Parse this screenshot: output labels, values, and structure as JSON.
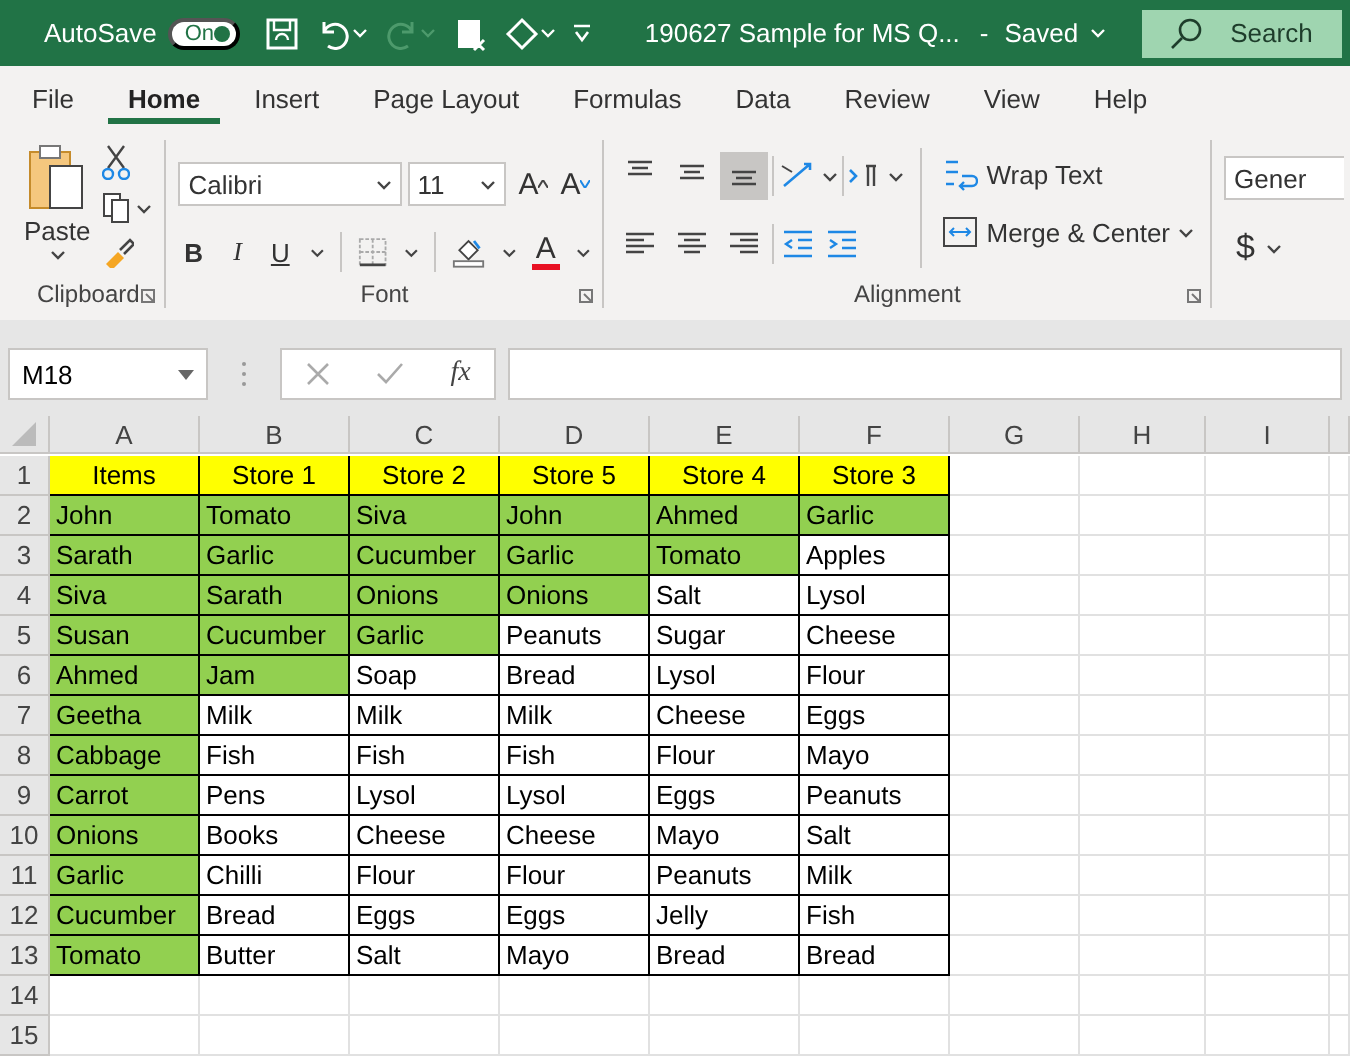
{
  "title_bar": {
    "autosave_label": "AutoSave",
    "autosave": {
      "label": "On",
      "on": true
    },
    "redo_disabled": true,
    "document_title": "190627 Sample for MS Q...",
    "separator": "-",
    "save_status": "Saved",
    "search": {
      "placeholder": "Search"
    }
  },
  "ribbon_tabs": [
    {
      "label": "File",
      "selected": false
    },
    {
      "label": "Home",
      "selected": true
    },
    {
      "label": "Insert",
      "selected": false
    },
    {
      "label": "Page Layout",
      "selected": false
    },
    {
      "label": "Formulas",
      "selected": false
    },
    {
      "label": "Data",
      "selected": false
    },
    {
      "label": "Review",
      "selected": false
    },
    {
      "label": "View",
      "selected": false
    },
    {
      "label": "Help",
      "selected": false
    }
  ],
  "ribbon": {
    "clipboard": {
      "paste": "Paste",
      "label": "Clipboard"
    },
    "font": {
      "name": "Calibri",
      "size": "11",
      "grow": "A",
      "shrink": "A",
      "bold": "B",
      "italic": "I",
      "underline": "U",
      "font_color": "A",
      "label": "Font"
    },
    "alignment": {
      "vertical": [
        {
          "kind": "top",
          "selected": false
        },
        {
          "kind": "middle",
          "selected": false
        },
        {
          "kind": "bottom",
          "selected": true
        }
      ],
      "wrap_text": "Wrap Text",
      "merge_center": "Merge & Center",
      "label": "Alignment"
    },
    "number": {
      "format": "Gener",
      "currency": "$"
    }
  },
  "formula_bar": {
    "name_box": "M18",
    "function_label": "fx"
  },
  "sheet": {
    "columns": [
      "A",
      "B",
      "C",
      "D",
      "E",
      "F",
      "G",
      "H",
      "I"
    ],
    "rows": [
      {
        "number": "1",
        "cells": [
          {
            "text": "Items",
            "color": "#ffff00"
          },
          {
            "text": "Store 1",
            "color": "#ffff00"
          },
          {
            "text": "Store 2",
            "color": "#ffff00"
          },
          {
            "text": "Store 5",
            "color": "#ffff00"
          },
          {
            "text": "Store 4",
            "color": "#ffff00"
          },
          {
            "text": "Store 3",
            "color": "#ffff00"
          }
        ]
      },
      {
        "number": "2",
        "cells": [
          {
            "text": "John",
            "color": "#92d050"
          },
          {
            "text": "Tomato",
            "color": "#92d050"
          },
          {
            "text": "Siva",
            "color": "#92d050"
          },
          {
            "text": "John",
            "color": "#92d050"
          },
          {
            "text": "Ahmed",
            "color": "#92d050"
          },
          {
            "text": "Garlic",
            "color": "#92d050"
          }
        ]
      },
      {
        "number": "3",
        "cells": [
          {
            "text": "Sarath",
            "color": "#92d050"
          },
          {
            "text": "Garlic",
            "color": "#92d050"
          },
          {
            "text": "Cucumber",
            "color": "#92d050"
          },
          {
            "text": "Garlic",
            "color": "#92d050"
          },
          {
            "text": "Tomato",
            "color": "#92d050"
          },
          {
            "text": "Apples",
            "color": "#ffffff"
          }
        ]
      },
      {
        "number": "4",
        "cells": [
          {
            "text": "Siva",
            "color": "#92d050"
          },
          {
            "text": "Sarath",
            "color": "#92d050"
          },
          {
            "text": "Onions",
            "color": "#92d050"
          },
          {
            "text": "Onions",
            "color": "#92d050"
          },
          {
            "text": "Salt",
            "color": "#ffffff"
          },
          {
            "text": "Lysol",
            "color": "#ffffff"
          }
        ]
      },
      {
        "number": "5",
        "cells": [
          {
            "text": "Susan",
            "color": "#92d050"
          },
          {
            "text": "Cucumber",
            "color": "#92d050"
          },
          {
            "text": "Garlic",
            "color": "#92d050"
          },
          {
            "text": "Peanuts",
            "color": "#ffffff"
          },
          {
            "text": "Sugar",
            "color": "#ffffff"
          },
          {
            "text": "Cheese",
            "color": "#ffffff"
          }
        ]
      },
      {
        "number": "6",
        "cells": [
          {
            "text": "Ahmed",
            "color": "#92d050"
          },
          {
            "text": "Jam",
            "color": "#92d050"
          },
          {
            "text": "Soap",
            "color": "#ffffff"
          },
          {
            "text": "Bread",
            "color": "#ffffff"
          },
          {
            "text": "Lysol",
            "color": "#ffffff"
          },
          {
            "text": "Flour",
            "color": "#ffffff"
          }
        ]
      },
      {
        "number": "7",
        "cells": [
          {
            "text": "Geetha",
            "color": "#92d050"
          },
          {
            "text": "Milk",
            "color": "#ffffff"
          },
          {
            "text": "Milk",
            "color": "#ffffff"
          },
          {
            "text": "Milk",
            "color": "#ffffff"
          },
          {
            "text": "Cheese",
            "color": "#ffffff"
          },
          {
            "text": "Eggs",
            "color": "#ffffff"
          }
        ]
      },
      {
        "number": "8",
        "cells": [
          {
            "text": "Cabbage",
            "color": "#92d050"
          },
          {
            "text": "Fish",
            "color": "#ffffff"
          },
          {
            "text": "Fish",
            "color": "#ffffff"
          },
          {
            "text": "Fish",
            "color": "#ffffff"
          },
          {
            "text": "Flour",
            "color": "#ffffff"
          },
          {
            "text": "Mayo",
            "color": "#ffffff"
          }
        ]
      },
      {
        "number": "9",
        "cells": [
          {
            "text": "Carrot",
            "color": "#92d050"
          },
          {
            "text": "Pens",
            "color": "#ffffff"
          },
          {
            "text": "Lysol",
            "color": "#ffffff"
          },
          {
            "text": "Lysol",
            "color": "#ffffff"
          },
          {
            "text": "Eggs",
            "color": "#ffffff"
          },
          {
            "text": "Peanuts",
            "color": "#ffffff"
          }
        ]
      },
      {
        "number": "10",
        "cells": [
          {
            "text": "Onions",
            "color": "#92d050"
          },
          {
            "text": "Books",
            "color": "#ffffff"
          },
          {
            "text": "Cheese",
            "color": "#ffffff"
          },
          {
            "text": "Cheese",
            "color": "#ffffff"
          },
          {
            "text": "Mayo",
            "color": "#ffffff"
          },
          {
            "text": "Salt",
            "color": "#ffffff"
          }
        ]
      },
      {
        "number": "11",
        "cells": [
          {
            "text": "Garlic",
            "color": "#92d050"
          },
          {
            "text": "Chilli",
            "color": "#ffffff"
          },
          {
            "text": "Flour",
            "color": "#ffffff"
          },
          {
            "text": "Flour",
            "color": "#ffffff"
          },
          {
            "text": "Peanuts",
            "color": "#ffffff"
          },
          {
            "text": "Milk",
            "color": "#ffffff"
          }
        ]
      },
      {
        "number": "12",
        "cells": [
          {
            "text": "Cucumber",
            "color": "#92d050"
          },
          {
            "text": "Bread",
            "color": "#ffffff"
          },
          {
            "text": "Eggs",
            "color": "#ffffff"
          },
          {
            "text": "Eggs",
            "color": "#ffffff"
          },
          {
            "text": "Jelly",
            "color": "#ffffff"
          },
          {
            "text": "Fish",
            "color": "#ffffff"
          }
        ]
      },
      {
        "number": "13",
        "cells": [
          {
            "text": "Tomato",
            "color": "#92d050"
          },
          {
            "text": "Butter",
            "color": "#ffffff"
          },
          {
            "text": "Salt",
            "color": "#ffffff"
          },
          {
            "text": "Mayo",
            "color": "#ffffff"
          },
          {
            "text": "Bread",
            "color": "#ffffff"
          },
          {
            "text": "Bread",
            "color": "#ffffff"
          }
        ]
      },
      {
        "number": "14"
      },
      {
        "number": "15"
      }
    ]
  }
}
